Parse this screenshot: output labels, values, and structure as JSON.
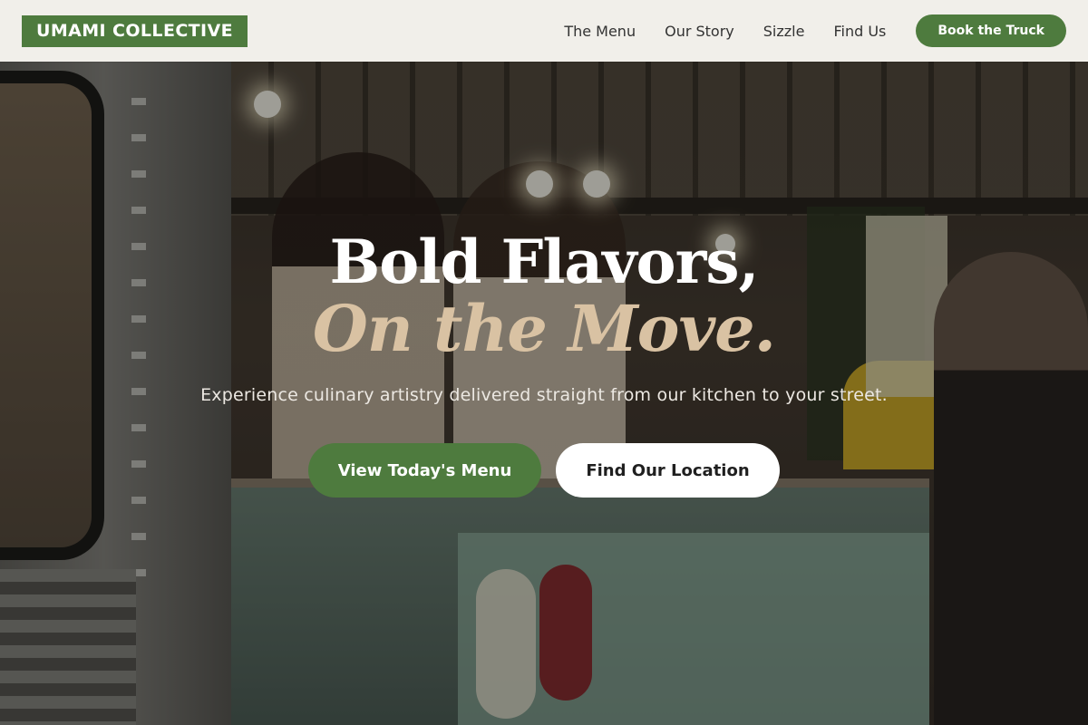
{
  "header": {
    "logo_text": "UMAMI COLLECTIVE",
    "nav": [
      {
        "label": "The Menu"
      },
      {
        "label": "Our Story"
      },
      {
        "label": "Sizzle"
      },
      {
        "label": "Find Us"
      }
    ],
    "book_button_label": "Book the Truck"
  },
  "hero": {
    "headline_line1": "Bold Flavors,",
    "headline_line2": "On the Move.",
    "subtitle": "Experience culinary artistry delivered straight from our kitchen to your street.",
    "primary_cta_label": "View Today's Menu",
    "secondary_cta_label": "Find Our Location",
    "background_image": "food-truck-photo"
  },
  "colors": {
    "brand_green": "#4e7b3e",
    "header_bg": "#f1efea",
    "accent_tan": "#d9c2a3",
    "white": "#ffffff"
  }
}
